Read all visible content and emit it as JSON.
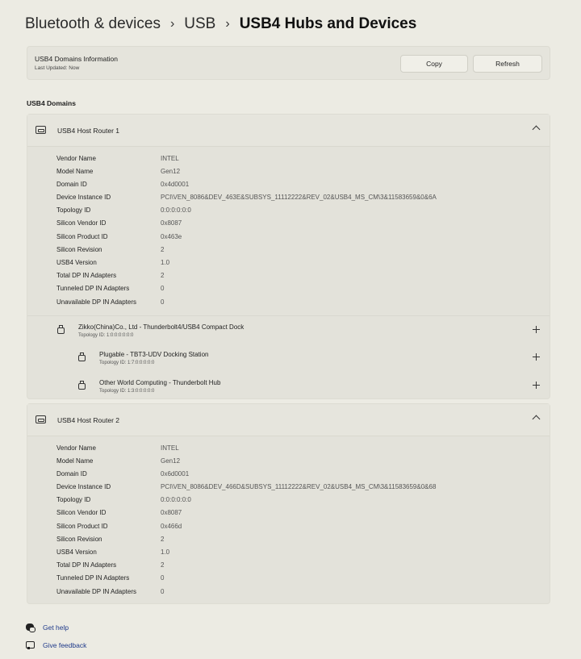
{
  "breadcrumb": {
    "item1": "Bluetooth & devices",
    "item2": "USB",
    "current": "USB4 Hubs and Devices",
    "separator": "›"
  },
  "info": {
    "title": "USB4 Domains Information",
    "last_updated": "Last Updated:  Now",
    "copy_label": "Copy",
    "refresh_label": "Refresh"
  },
  "section_title": "USB4 Domains",
  "router1": {
    "title": "USB4 Host Router 1",
    "props": [
      {
        "label": "Vendor Name",
        "value": "INTEL"
      },
      {
        "label": "Model Name",
        "value": "Gen12"
      },
      {
        "label": "Domain ID",
        "value": "0x4d0001"
      },
      {
        "label": "Device Instance ID",
        "value": "PCI\\VEN_8086&DEV_463E&SUBSYS_11112222&REV_02&USB4_MS_CM\\3&11583659&0&6A"
      },
      {
        "label": "Topology ID",
        "value": "0:0:0:0:0:0"
      },
      {
        "label": "Silicon Vendor ID",
        "value": "0x8087"
      },
      {
        "label": "Silicon Product ID",
        "value": "0x463e"
      },
      {
        "label": "Silicon Revision",
        "value": "2"
      },
      {
        "label": "USB4 Version",
        "value": "1.0"
      },
      {
        "label": "Total DP IN Adapters",
        "value": "2"
      },
      {
        "label": "Tunneled DP IN Adapters",
        "value": "0"
      },
      {
        "label": "Unavailable DP IN Adapters",
        "value": "0"
      }
    ],
    "devices": [
      {
        "title": "Zikko(China)Co., Ltd - Thunderbolt4/USB4 Compact Dock",
        "topology": "Topology ID:  1:0:0:0:0:0:0"
      },
      {
        "title": "Plugable - TBT3-UDV Docking Station",
        "topology": "Topology ID:  1:7:0:0:0:0:0"
      },
      {
        "title": "Other World Computing - Thunderbolt Hub",
        "topology": "Topology ID:  1:3:0:0:0:0:0"
      }
    ]
  },
  "router2": {
    "title": "USB4 Host Router 2",
    "props": [
      {
        "label": "Vendor Name",
        "value": "INTEL"
      },
      {
        "label": "Model Name",
        "value": "Gen12"
      },
      {
        "label": "Domain ID",
        "value": "0x6d0001"
      },
      {
        "label": "Device Instance ID",
        "value": "PCI\\VEN_8086&DEV_466D&SUBSYS_11112222&REV_02&USB4_MS_CM\\3&11583659&0&68"
      },
      {
        "label": "Topology ID",
        "value": "0:0:0:0:0:0"
      },
      {
        "label": "Silicon Vendor ID",
        "value": "0x8087"
      },
      {
        "label": "Silicon Product ID",
        "value": "0x466d"
      },
      {
        "label": "Silicon Revision",
        "value": "2"
      },
      {
        "label": "USB4 Version",
        "value": "1.0"
      },
      {
        "label": "Total DP IN Adapters",
        "value": "2"
      },
      {
        "label": "Tunneled DP IN Adapters",
        "value": "0"
      },
      {
        "label": "Unavailable DP IN Adapters",
        "value": "0"
      }
    ]
  },
  "footer": {
    "help": "Get help",
    "feedback": "Give feedback"
  }
}
